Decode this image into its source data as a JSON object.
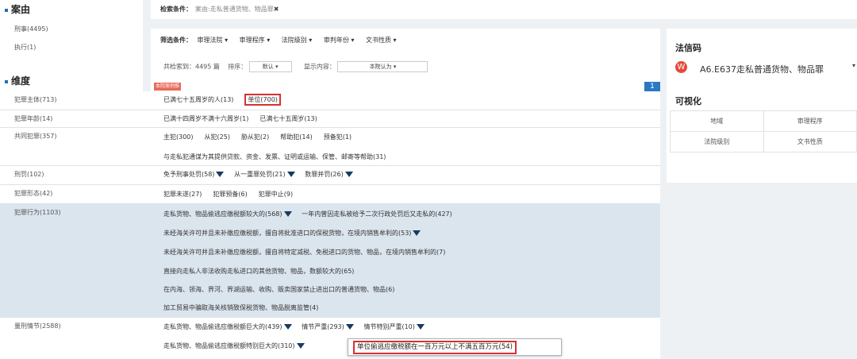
{
  "left": {
    "case_title": "案由",
    "case_items": [
      "刑事(4495)",
      "执行(1)"
    ],
    "dim_title": "维度"
  },
  "search": {
    "label": "检索条件：",
    "value": "案由:走私普通货物、物品罪",
    "close": "✖"
  },
  "filters": {
    "label": "筛选条件：",
    "items": [
      "审理法院 ▾",
      "审理程序 ▾",
      "法院级别 ▾",
      "审判年份 ▾",
      "文书性质 ▾"
    ]
  },
  "results": {
    "count_text": "共检索到：4495 篇",
    "sort_label": "排序：",
    "sort_value": "默认 ▾",
    "display_label": "显示内容：",
    "display_value": "本院认为 ▾",
    "tag": "本院案例推荐",
    "page_num": "1"
  },
  "right": {
    "fxm_title": "法信码",
    "fxm_icon": "W",
    "fxm_code": "A6.E637走私普通货物、物品罪",
    "fxm_caret": "▾",
    "viz_title": "可视化",
    "viz_cells": [
      "地域",
      "审理程序",
      "法院级别",
      "文书性质"
    ]
  },
  "dimensions": [
    {
      "label": "犯罪主体(713)",
      "lines": [
        [
          "已满七十五周岁的人(13)",
          "单位(700)"
        ]
      ]
    },
    {
      "label": "犯罪年龄(14)",
      "lines": [
        [
          "已满十四周岁不满十六周岁(1)",
          "已满七十五周岁(13)"
        ]
      ]
    },
    {
      "label": "共同犯罪(357)",
      "lines": [
        [
          "主犯(300)",
          "从犯(25)",
          "胁从犯(2)",
          "帮助犯(14)",
          "预备犯(1)"
        ],
        [
          "与走私犯通谋为其提供贷款、资金、发票、证明或运输、保管、邮寄等帮助(31)"
        ]
      ]
    },
    {
      "label": "刑罚(102)",
      "lines": [
        [
          "免予刑事处罚(58)",
          "从一重罪处罚(21)",
          "数罪并罚(26)"
        ]
      ]
    },
    {
      "label": "犯罪形态(42)",
      "lines": [
        [
          "犯罪未遂(27)",
          "犯罪预备(6)",
          "犯罪中止(9)"
        ]
      ]
    },
    {
      "label": "犯罪行为(1103)",
      "lines": [
        [
          "走私货物、物品偷逃应缴税额较大的(568)",
          "一年内曾因走私被给予二次行政处罚后又走私的(427)"
        ],
        [
          "未经海关许可并且未补缴应缴税额，擅自将批准进口的保税货物，在境内销售牟利的(53)"
        ],
        [
          "未经海关许可并且未补缴应缴税额，擅自将特定减税、免税进口的货物、物品，在境内销售牟利的(7)"
        ],
        [
          "直接向走私人非法收购走私进口的其他货物、物品，数额较大的(65)"
        ],
        [
          "在内海、领海、界河、界湖运输、收购、贩卖国家禁止进出口的普通货物、物品(6)"
        ],
        [
          "加工贸易中骗取海关核销致保税货物、物品脱离监管(4)"
        ]
      ]
    },
    {
      "label": "量刑情节(2588)",
      "lines": [
        [
          "走私货物、物品偷逃应缴税额巨大的(439)",
          "情节严重(293)",
          "情节特别严重(10)"
        ],
        [
          "走私货物、物品偷逃应缴税额特别巨大的(310)"
        ]
      ]
    }
  ],
  "tooltip": "单位偷逃应缴税额在一百万元以上不满五百万元(54)"
}
